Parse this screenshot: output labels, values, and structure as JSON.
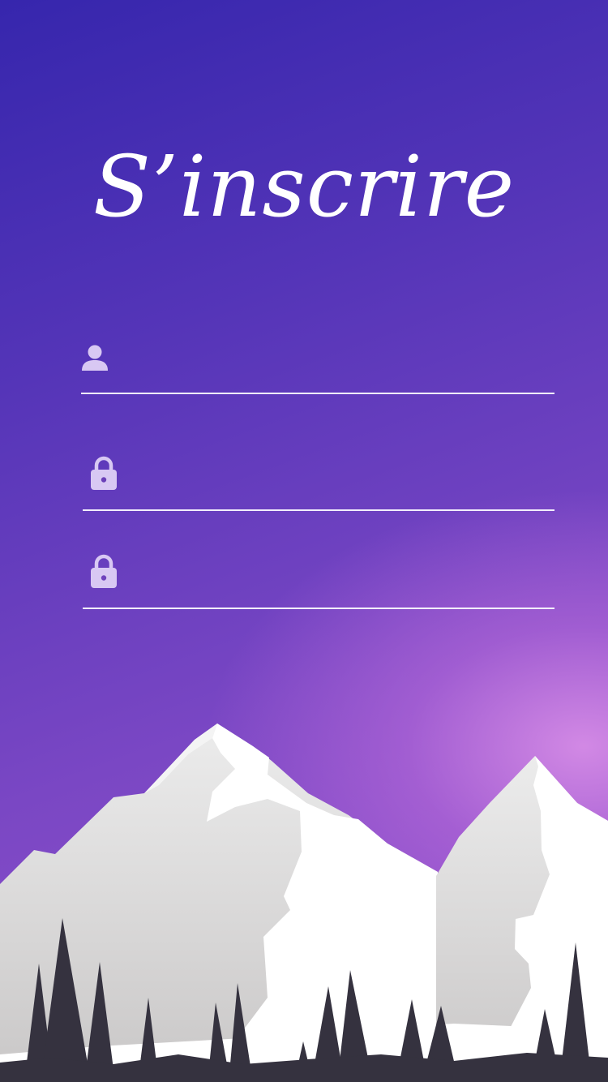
{
  "header": {
    "title": "S’inscrire"
  },
  "form": {
    "username": {
      "icon": "user-icon",
      "value": "",
      "placeholder": ""
    },
    "password": {
      "icon": "lock-icon",
      "value": "",
      "placeholder": ""
    },
    "confirm_password": {
      "icon": "lock-icon",
      "value": "",
      "placeholder": ""
    }
  },
  "theme": {
    "background_top": "#3626ad",
    "background_bottom": "#9a55cf",
    "glow": "#d68ce6",
    "icon_color": "#d8c8f3",
    "line_color": "#f2eefc",
    "tree_color": "#35323f"
  }
}
